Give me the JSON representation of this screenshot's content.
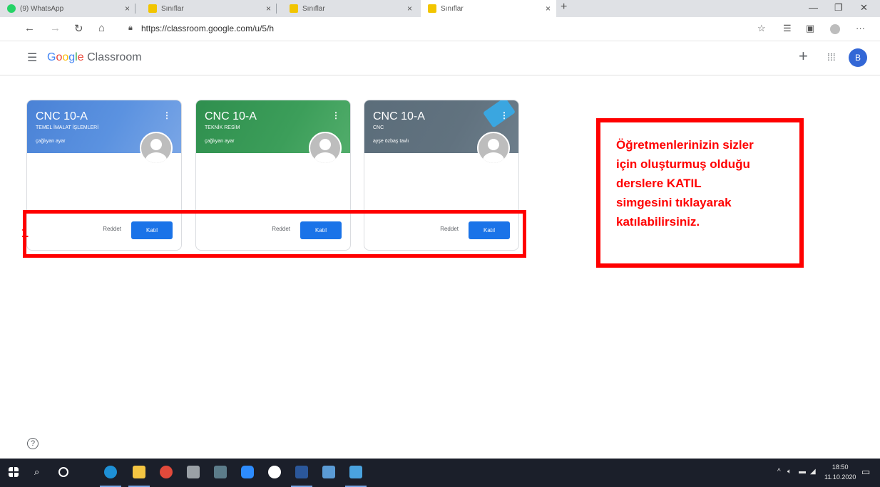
{
  "browser": {
    "tabs": [
      {
        "title": "(9) WhatsApp"
      },
      {
        "title": "Sınıflar"
      },
      {
        "title": "Sınıflar"
      },
      {
        "title": "Sınıflar"
      }
    ],
    "url": "https://classroom.google.com/u/5/h",
    "profile_initial": "B"
  },
  "app": {
    "brand_google": [
      "G",
      "o",
      "o",
      "g",
      "l",
      "e"
    ],
    "brand_product": "Classroom"
  },
  "cards": [
    {
      "title": "CNC 10-A",
      "subtitle": "TEMEL İMALAT İŞLEMLERİ",
      "teacher": "çağlıyan ayar",
      "decline": "Reddet",
      "join": "Katıl"
    },
    {
      "title": "CNC 10-A",
      "subtitle": "TEKNİK RESİM",
      "teacher": "çağlıyan ayar",
      "decline": "Reddet",
      "join": "Katıl"
    },
    {
      "title": "CNC 10-A",
      "subtitle": "CNC",
      "teacher": "ayşe özbaş tavlı",
      "decline": "Reddet",
      "join": "Katıl"
    }
  ],
  "annotation": {
    "marker": "1",
    "lines": [
      "Öğretmenlerinizin sizler",
      "için oluşturmuş olduğu",
      "derslere KATIL",
      "simgesini tıklayarak",
      "katılabilirsiniz."
    ]
  },
  "taskbar": {
    "time": "18:50",
    "date": "11.10.2020"
  }
}
